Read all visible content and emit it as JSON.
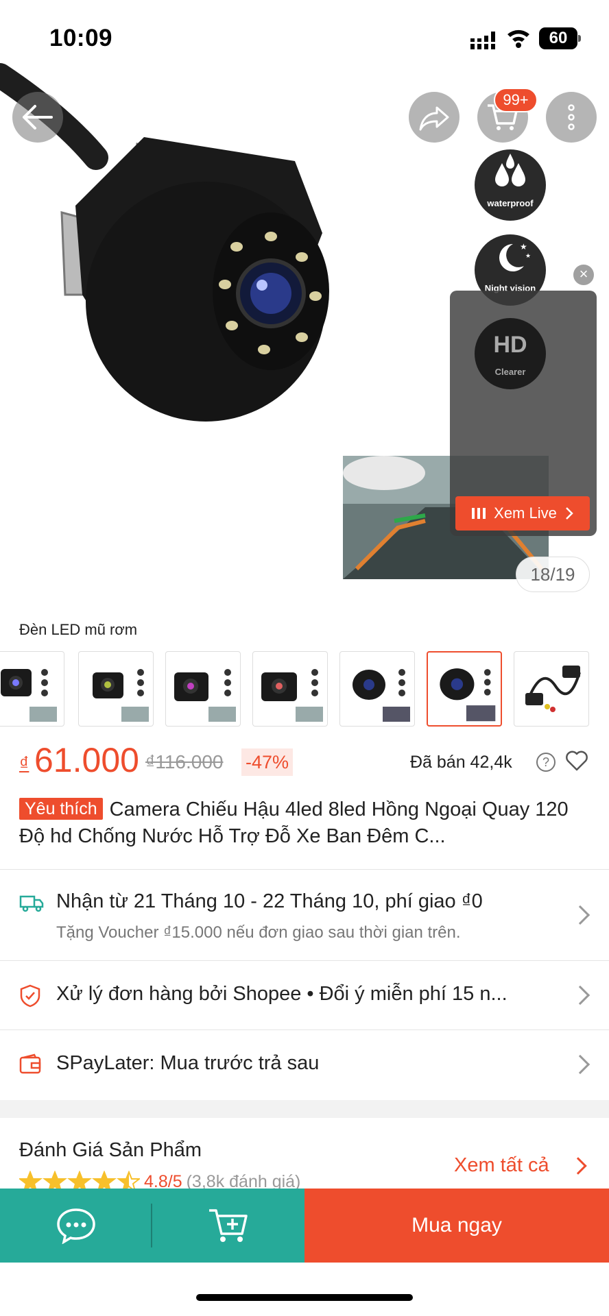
{
  "status_bar": {
    "time": "10:09",
    "battery": "60"
  },
  "hero": {
    "cart_badge": "99+",
    "features": [
      {
        "icon": "waterproof-icon",
        "caption": "waterproof"
      },
      {
        "icon": "moon-icon",
        "caption": "Night vision"
      },
      {
        "icon": "hd-icon",
        "caption": "Clearer"
      }
    ],
    "hd_text": "HD",
    "live_button_label": "Xem Live",
    "image_counter": "18/19"
  },
  "variant": {
    "label": "Đèn LED mũ rơm",
    "thumbnail_count": 7,
    "selected_index": 5
  },
  "price": {
    "currency": "₫",
    "current": "61.000",
    "original": "₫116.000",
    "discount": "-47%",
    "sold": "Đã bán 42,4k"
  },
  "product": {
    "tag": "Yêu thích",
    "title": "Camera Chiếu Hậu 4led 8led Hồng Ngoại Quay 120 Độ hd Chống Nước Hỗ Trợ Đỗ Xe Ban Đêm C..."
  },
  "shipping": {
    "main": "Nhận từ 21 Tháng 10 - 22 Tháng 10, phí giao ₫0",
    "sub": "Tặng Voucher ₫15.000 nếu đơn giao sau thời gian trên."
  },
  "guarantee": {
    "text": "Xử lý đơn hàng bởi Shopee  •  Đổi ý miễn phí 15 n..."
  },
  "paylater": {
    "text": "SPayLater: Mua trước trả sau"
  },
  "rating": {
    "title": "Đánh Giá Sản Phẩm",
    "stars": 4.8,
    "score": "4.8/5",
    "count": "(3,8k đánh giá)",
    "see_all": "Xem tất cả"
  },
  "bottom_bar": {
    "buy_now": "Mua ngay"
  },
  "colors": {
    "accent": "#ee4d2d",
    "teal": "#26aa99"
  }
}
